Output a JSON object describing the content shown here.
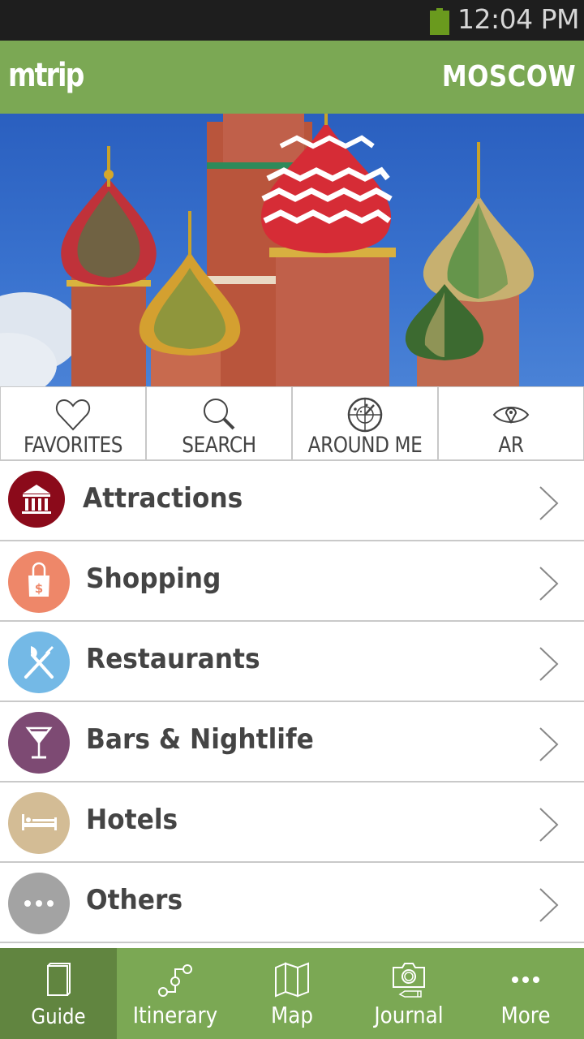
{
  "status_bar": {
    "time": "12:04 PM",
    "battery_icon": "battery-icon",
    "battery_color": "#6a9a1e"
  },
  "header": {
    "logo": "mtrip",
    "city": "MOSCOW",
    "background": "#7ba854"
  },
  "hero": {
    "description": "St. Basil's Cathedral onion domes against blue sky"
  },
  "quick_actions": [
    {
      "label": "FAVORITES",
      "icon": "heart-icon"
    },
    {
      "label": "SEARCH",
      "icon": "search-icon"
    },
    {
      "label": "AROUND ME",
      "icon": "radar-icon"
    },
    {
      "label": "AR",
      "icon": "eye-location-icon"
    }
  ],
  "categories": [
    {
      "label": "Attractions",
      "icon": "museum-icon",
      "color": "#8b0a1a"
    },
    {
      "label": "Shopping",
      "icon": "shopping-bag-icon",
      "color": "#ee8769"
    },
    {
      "label": "Restaurants",
      "icon": "fork-knife-icon",
      "color": "#74b9e6"
    },
    {
      "label": "Bars & Nightlife",
      "icon": "cocktail-icon",
      "color": "#7d4a73"
    },
    {
      "label": "Hotels",
      "icon": "bed-icon",
      "color": "#d3bc95"
    },
    {
      "label": "Others",
      "icon": "more-dots-icon",
      "color": "#a3a3a3"
    }
  ],
  "tabs": [
    {
      "label": "Guide",
      "icon": "book-icon",
      "active": true
    },
    {
      "label": "Itinerary",
      "icon": "route-icon",
      "active": false
    },
    {
      "label": "Map",
      "icon": "map-icon",
      "active": false
    },
    {
      "label": "Journal",
      "icon": "camera-pencil-icon",
      "active": false
    },
    {
      "label": "More",
      "icon": "more-dots-icon",
      "active": false
    }
  ]
}
